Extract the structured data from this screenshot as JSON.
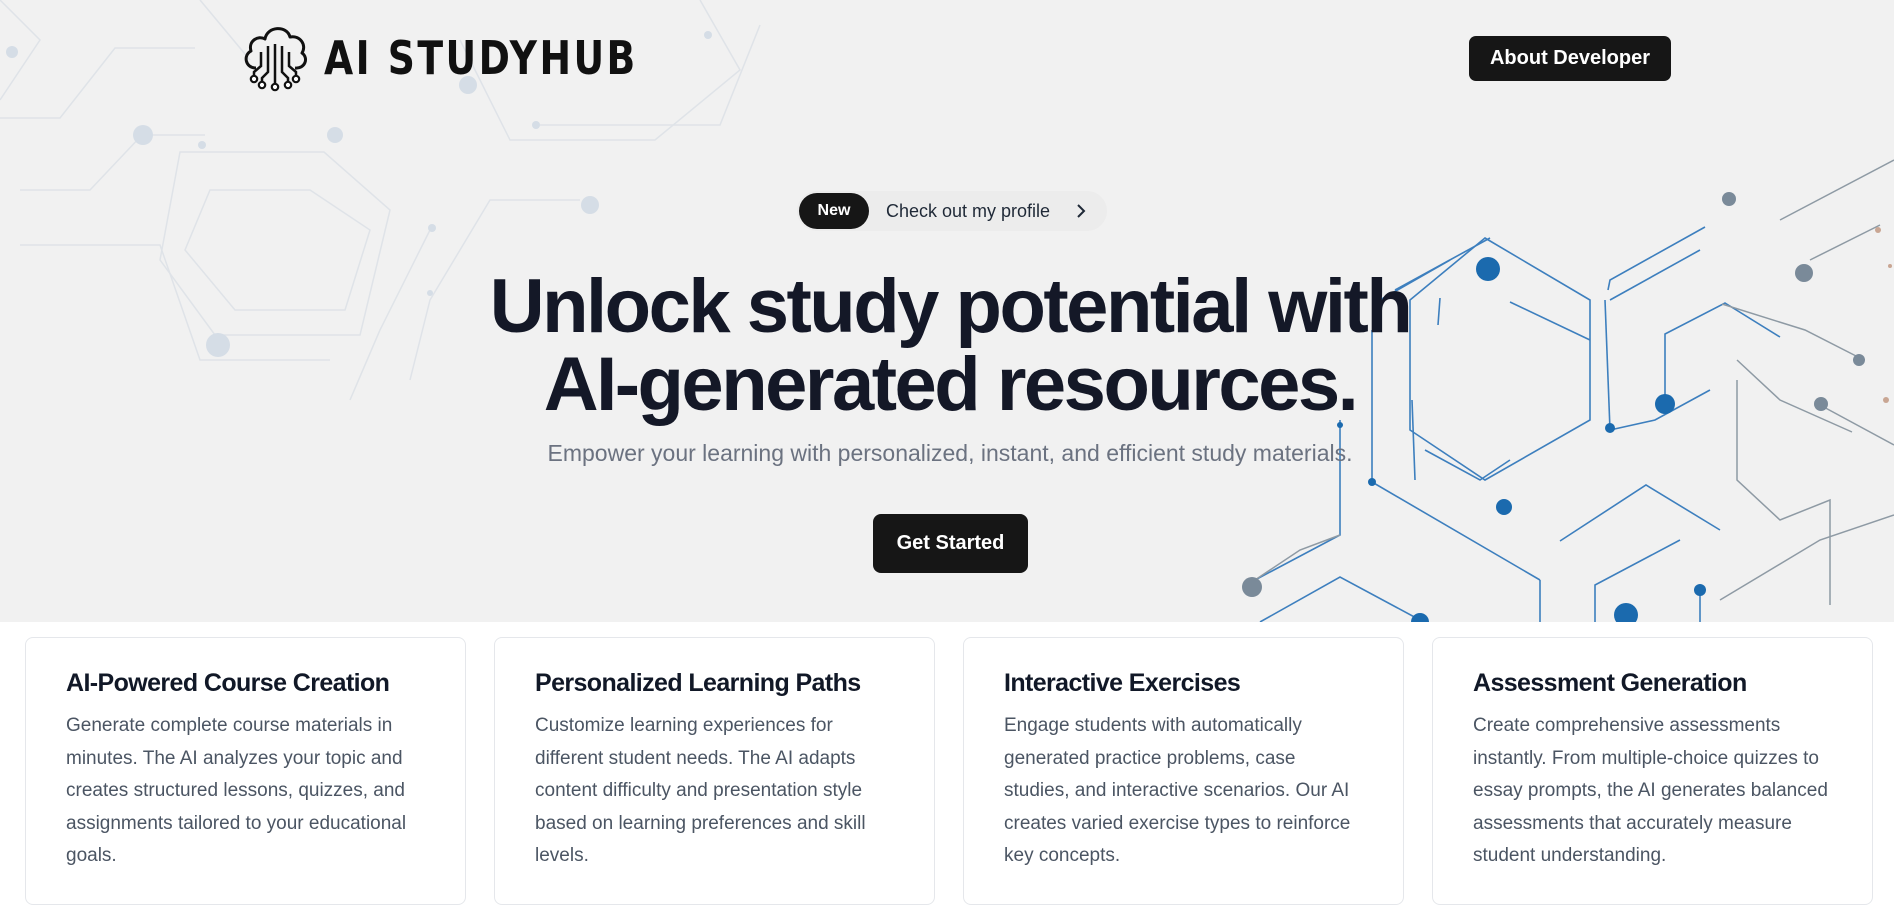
{
  "header": {
    "brand": "AI STUDYHUB",
    "logo_icon": "cloud-circuit-icon",
    "about_label": "About Developer"
  },
  "announcement": {
    "badge": "New",
    "text": "Check out my profile",
    "arrow_icon": "chevron-right-icon"
  },
  "hero": {
    "headline_line1": "Unlock study potential with",
    "headline_line2": "AI-generated resources.",
    "subheadline": "Empower your learning with personalized, instant, and efficient study materials.",
    "cta_label": "Get Started"
  },
  "features": [
    {
      "title": "AI-Powered Course Creation",
      "description": "Generate complete course materials in minutes. The AI analyzes your topic and creates structured lessons, quizzes, and assignments tailored to your educational goals."
    },
    {
      "title": "Personalized Learning Paths",
      "description": "Customize learning experiences for different student needs. The AI adapts content difficulty and presentation style based on learning preferences and skill levels."
    },
    {
      "title": "Interactive Exercises",
      "description": "Engage students with automatically generated practice problems, case studies, and interactive scenarios. Our AI creates varied exercise types to reinforce key concepts."
    },
    {
      "title": "Assessment Generation",
      "description": "Create comprehensive assessments instantly. From multiple-choice quizzes to essay prompts, the AI generates balanced assessments that accurately measure student understanding."
    }
  ],
  "colors": {
    "hero_bg": "#f1f1f1",
    "button_bg": "#161616",
    "circuit_blue": "#1d6fb3",
    "circuit_gray": "#8a959e"
  }
}
